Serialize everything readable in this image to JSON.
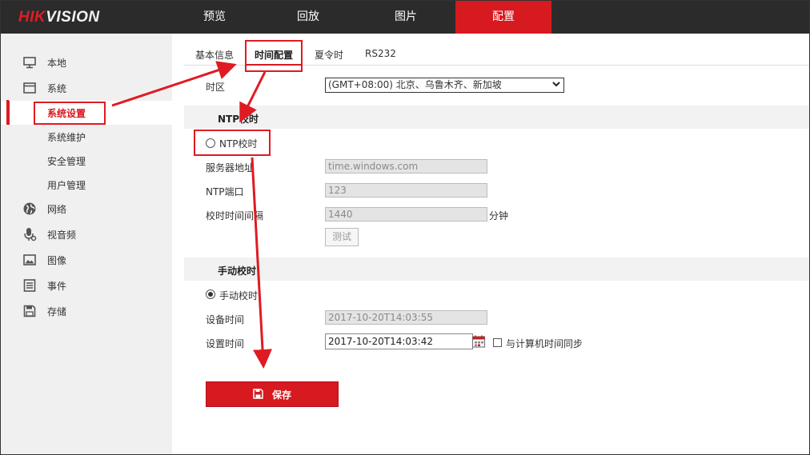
{
  "header": {
    "logo_accent": "HIK",
    "logo_rest": "VISION",
    "nav": [
      {
        "label": "预览"
      },
      {
        "label": "回放"
      },
      {
        "label": "图片"
      },
      {
        "label": "配置",
        "active": true
      }
    ]
  },
  "sidebar": {
    "items": [
      {
        "label": "本地",
        "icon": "monitor-icon"
      },
      {
        "label": "系统",
        "icon": "window-icon"
      },
      {
        "label": "系统设置",
        "active": true
      },
      {
        "label": "系统维护"
      },
      {
        "label": "安全管理"
      },
      {
        "label": "用户管理"
      },
      {
        "label": "网络",
        "icon": "globe-icon"
      },
      {
        "label": "视音频",
        "icon": "microphone-icon"
      },
      {
        "label": "图像",
        "icon": "image-icon"
      },
      {
        "label": "事件",
        "icon": "list-icon"
      },
      {
        "label": "存储",
        "icon": "floppy-icon"
      }
    ]
  },
  "tabs": [
    {
      "label": "基本信息"
    },
    {
      "label": "时间配置",
      "active": true
    },
    {
      "label": "夏令时"
    },
    {
      "label": "RS232"
    }
  ],
  "timezone": {
    "label": "时区",
    "value": "(GMT+08:00) 北京、乌鲁木齐、新加坡"
  },
  "ntp": {
    "section_title": "NTP校时",
    "radio_label": "NTP校时",
    "server_label": "服务器地址",
    "server_value": "time.windows.com",
    "port_label": "NTP端口",
    "port_value": "123",
    "interval_label": "校时时间间隔",
    "interval_value": "1440",
    "interval_unit": "分钟",
    "test_button": "测试"
  },
  "manual": {
    "section_title": "手动校时",
    "radio_label": "手动校时",
    "device_time_label": "设备时间",
    "device_time_value": "2017-10-20T14:03:55",
    "set_time_label": "设置时间",
    "set_time_value": "2017-10-20T14:03:42",
    "sync_label": "与计算机时间同步"
  },
  "save_button": "保存",
  "colors": {
    "accent": "#d71920",
    "topbar": "#2b2b2b",
    "sidebar_bg": "#f0f0f0",
    "annotation": "#e01a22"
  }
}
